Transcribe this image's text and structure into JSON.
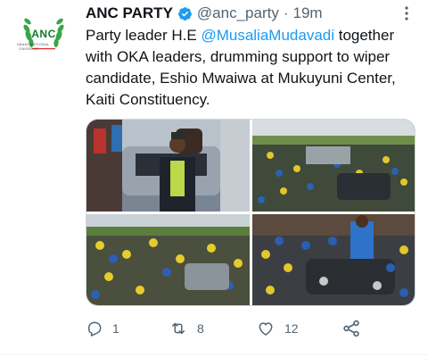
{
  "tweet": {
    "display_name": "ANC PARTY",
    "handle": "@anc_party",
    "separator": "·",
    "time": "19m",
    "text_part1": "Party leader H.E ",
    "mention": "@MusaliaMudavadi",
    "text_part2": " together with OKA leaders, drumming support to wiper candidate, Eshio Mwaiwa at Mukuyuni Center, Kaiti Constituency.",
    "avatar_logo_text": "ANC",
    "avatar_logo_subtext": "AMANI NATIONAL CONGRESS",
    "verified_icon": "verified-badge-icon",
    "photos": [
      {
        "name": "photo-leader-on-vehicle",
        "icon": "photo"
      },
      {
        "name": "photo-crowd-wide",
        "icon": "photo"
      },
      {
        "name": "photo-crowd-yellow-blue",
        "icon": "photo"
      },
      {
        "name": "photo-crowd-blue-shirt",
        "icon": "photo"
      }
    ]
  },
  "actions": {
    "reply_count": "1",
    "retweet_count": "8",
    "like_count": "12",
    "share_icon": "share-icon"
  },
  "colors": {
    "accent": "#1d9bf0",
    "secondary_text": "#536471",
    "primary_text": "#0f1419",
    "logo_green": "#137a2e"
  }
}
